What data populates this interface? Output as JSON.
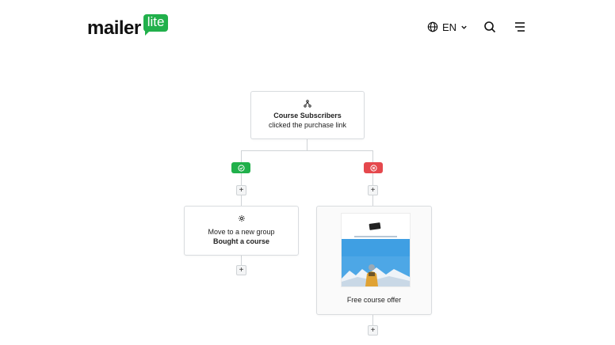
{
  "header": {
    "logo_text": "mailer",
    "logo_badge": "lite",
    "language": "EN",
    "brand_color": "#21b04b"
  },
  "workflow": {
    "trigger": {
      "title": "Course Subscribers",
      "subtitle": "clicked the purchase link",
      "icon": "branch-icon"
    },
    "yes_branch": {
      "color": "#21b04b",
      "icon": "check-circle-icon"
    },
    "no_branch": {
      "color": "#e5484d",
      "icon": "close-circle-icon"
    },
    "action_left": {
      "line1": "Move to a new group",
      "line2": "Bought a course",
      "icon": "gear-icon"
    },
    "action_right": {
      "label": "Free course offer"
    },
    "add_step_symbol": "+"
  }
}
